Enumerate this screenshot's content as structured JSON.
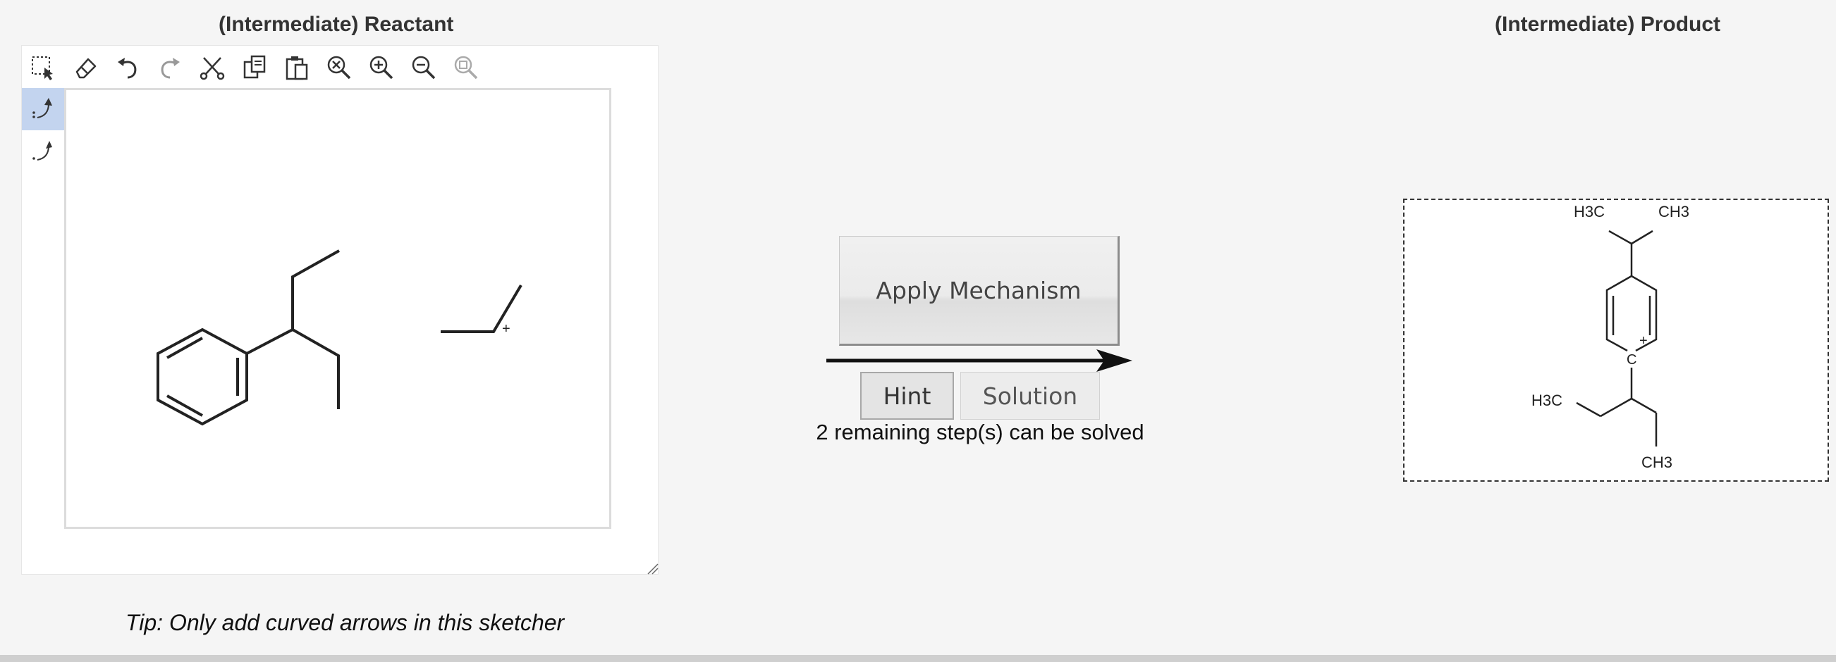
{
  "reactant_panel": {
    "title": "(Intermediate) Reactant",
    "toolbar": [
      {
        "name": "select-tool",
        "icon": "rectangle-select-icon"
      },
      {
        "name": "erase-tool",
        "icon": "eraser-icon"
      },
      {
        "name": "undo-tool",
        "icon": "undo-icon"
      },
      {
        "name": "redo-tool",
        "icon": "redo-icon"
      },
      {
        "name": "cut-tool",
        "icon": "scissors-icon"
      },
      {
        "name": "copy-tool",
        "icon": "copy-icon"
      },
      {
        "name": "paste-tool",
        "icon": "paste-icon"
      },
      {
        "name": "zoom-reset-tool",
        "icon": "zoom-reset-icon"
      },
      {
        "name": "zoom-in-tool",
        "icon": "zoom-in-icon"
      },
      {
        "name": "zoom-out-tool",
        "icon": "zoom-out-icon"
      },
      {
        "name": "zoom-fit-tool",
        "icon": "zoom-fit-icon"
      }
    ],
    "side_tools": [
      {
        "name": "electron-pair-arrow-tool",
        "icon": "curved-arrow-pair-icon",
        "active": true
      },
      {
        "name": "single-electron-arrow-tool",
        "icon": "curved-arrow-single-icon",
        "active": false
      }
    ],
    "carbocation_charge": "+",
    "tip": "Tip: Only add curved arrows in this sketcher"
  },
  "controls": {
    "apply_label": "Apply Mechanism",
    "hint_label": "Hint",
    "solution_label": "Solution",
    "steps_text": "2 remaining step(s) can be solved"
  },
  "product_panel": {
    "title": "(Intermediate) Product",
    "labels": {
      "h3c_top": "H3C",
      "ch3_top": "CH3",
      "h3c_left": "H3C",
      "ch3_bottom": "CH3",
      "charge": "+",
      "carbon": "C"
    }
  }
}
